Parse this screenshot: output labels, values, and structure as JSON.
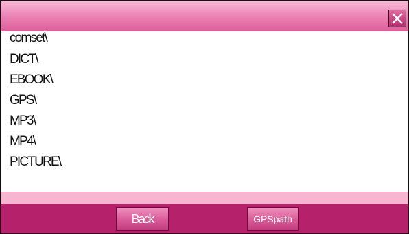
{
  "titlebar": {
    "close_icon": "close-x-icon"
  },
  "file_list": {
    "items": [
      {
        "label": "comset\\"
      },
      {
        "label": "DICT\\"
      },
      {
        "label": "EBOOK\\"
      },
      {
        "label": "GPS\\"
      },
      {
        "label": "MP3\\"
      },
      {
        "label": "MP4\\"
      },
      {
        "label": "PICTURE\\"
      }
    ]
  },
  "footer": {
    "back_label": "Back",
    "gpspath_label": "GPSpath"
  },
  "colors": {
    "titlebar_pink": "#ee89b9",
    "status_strip_pink": "#f8b5d2",
    "footer_magenta": "#b5226b",
    "button_pink": "#d95a98"
  }
}
